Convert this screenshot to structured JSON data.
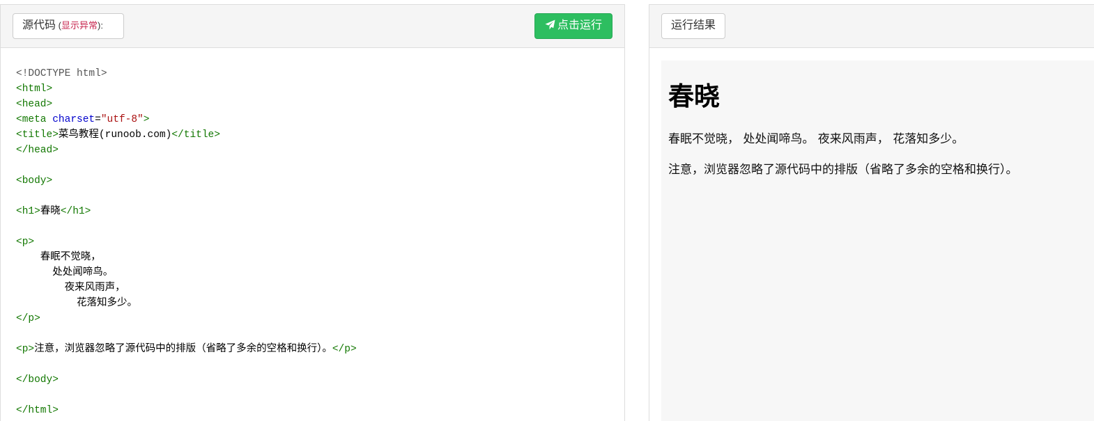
{
  "left_panel": {
    "source_button": {
      "label": "源代码",
      "paren_open": " (",
      "warn": "显示异常",
      "paren_close": "):"
    },
    "run_button": {
      "label": "点击运行",
      "icon": "paper-plane-icon"
    }
  },
  "right_panel": {
    "result_button": {
      "label": "运行结果"
    }
  },
  "code_lines": [
    [
      {
        "t": "doc",
        "v": "<!DOCTYPE html>"
      }
    ],
    [
      {
        "t": "tag",
        "v": "<html>"
      }
    ],
    [
      {
        "t": "tag",
        "v": "<head>"
      }
    ],
    [
      {
        "t": "tag",
        "v": "<meta "
      },
      {
        "t": "attr",
        "v": "charset"
      },
      {
        "t": "txt",
        "v": "="
      },
      {
        "t": "str",
        "v": "\"utf-8\""
      },
      {
        "t": "tag",
        "v": ">"
      }
    ],
    [
      {
        "t": "tag",
        "v": "<title>"
      },
      {
        "t": "txt",
        "v": "菜鸟教程(runoob.com)"
      },
      {
        "t": "tag",
        "v": "</title>"
      }
    ],
    [
      {
        "t": "tag",
        "v": "</head>"
      }
    ],
    [],
    [
      {
        "t": "tag",
        "v": "<body>"
      }
    ],
    [],
    [
      {
        "t": "tag",
        "v": "<h1>"
      },
      {
        "t": "txt",
        "v": "春晓"
      },
      {
        "t": "tag",
        "v": "</h1>"
      }
    ],
    [],
    [
      {
        "t": "tag",
        "v": "<p>"
      }
    ],
    [
      {
        "t": "txt",
        "v": "    春眠不觉晓，"
      }
    ],
    [
      {
        "t": "txt",
        "v": "      处处闻啼鸟。"
      }
    ],
    [
      {
        "t": "txt",
        "v": "        夜来风雨声，"
      }
    ],
    [
      {
        "t": "txt",
        "v": "          花落知多少。"
      }
    ],
    [
      {
        "t": "tag",
        "v": "</p>"
      }
    ],
    [],
    [
      {
        "t": "tag",
        "v": "<p>"
      },
      {
        "t": "txt",
        "v": "注意，浏览器忽略了源代码中的排版（省略了多余的空格和换行）。"
      },
      {
        "t": "tag",
        "v": "</p>"
      }
    ],
    [],
    [
      {
        "t": "tag",
        "v": "</body>"
      }
    ],
    [],
    [
      {
        "t": "tag",
        "v": "</html>"
      }
    ]
  ],
  "preview": {
    "heading": "春晓",
    "paragraph1": "春眠不觉晓， 处处闻啼鸟。 夜来风雨声， 花落知多少。",
    "paragraph2": "注意，浏览器忽略了源代码中的排版（省略了多余的空格和换行）。"
  },
  "colors": {
    "run_button": "#2dbe60",
    "warn_text": "#c7254e",
    "tag": "#117700",
    "attr": "#0000cc",
    "string": "#aa1111",
    "doctype": "#555555"
  }
}
